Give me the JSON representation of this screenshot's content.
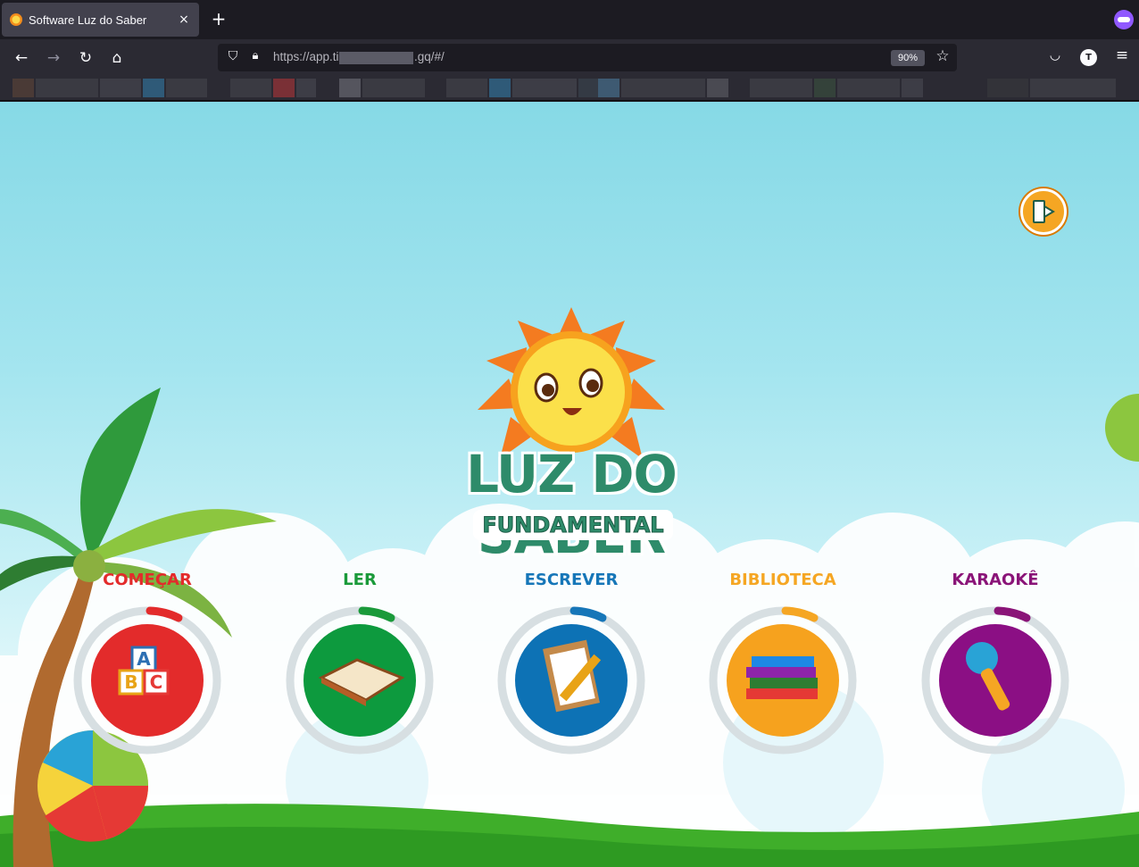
{
  "browser": {
    "tab_title": "Software Luz do Saber",
    "tab_close": "×",
    "new_tab": "+",
    "url_prefix": "https://app.ti",
    "url_suffix": ".gq/#/",
    "zoom": "90%",
    "profile_initial": "T"
  },
  "page": {
    "logo_title": "LUZ DO SABER",
    "logo_subtitle": "FUNDAMENTAL",
    "menu": [
      {
        "label": "COMEÇAR",
        "color": "#e32b2b",
        "circle": "#e32b2b",
        "icon": "abc-blocks-icon"
      },
      {
        "label": "LER",
        "color": "#1a9a3a",
        "circle": "#0d9a3e",
        "icon": "open-book-icon"
      },
      {
        "label": "ESCREVER",
        "color": "#1676b8",
        "circle": "#0d72b5",
        "icon": "clipboard-pencil-icon"
      },
      {
        "label": "BIBLIOTECA",
        "color": "#f5a623",
        "circle": "#f6a21e",
        "icon": "book-stack-icon"
      },
      {
        "label": "KARAOKÊ",
        "color": "#8a1478",
        "circle": "#8b0f84",
        "icon": "microphone-icon"
      }
    ]
  }
}
